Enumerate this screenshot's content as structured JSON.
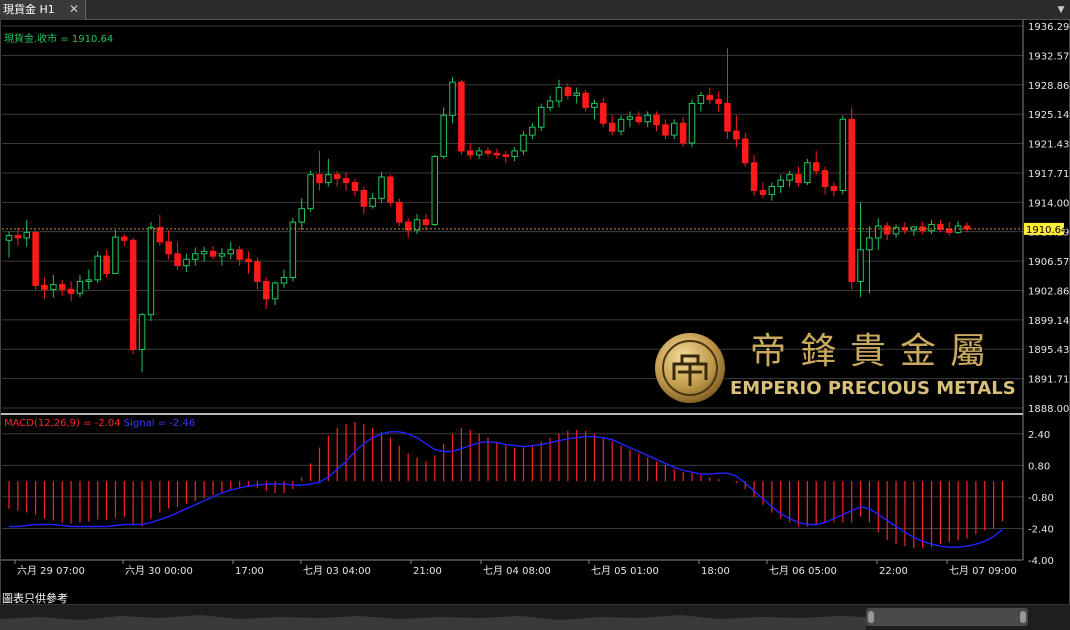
{
  "tab": {
    "title": "現貨金 H1",
    "close": "✕",
    "menu": "▼"
  },
  "legend": {
    "main": "現貨金.收市 = 1910.64",
    "macd_name": "MACD(12,26,9) = -2.04",
    "signal_name": "Signal = -2.46"
  },
  "price_axis": {
    "ticks": [
      "1936.29",
      "1932.57",
      "1928.86",
      "1925.14",
      "1921.43",
      "1917.71",
      "1914.00",
      "1910.29",
      "1906.57",
      "1902.86",
      "1899.14",
      "1895.43",
      "1891.71",
      "1888.00"
    ],
    "current_label": "1910.64"
  },
  "macd_axis": {
    "ticks": [
      "2.40",
      "0.80",
      "-0.80",
      "-2.40",
      "-4.00"
    ]
  },
  "time_axis": {
    "labels": [
      "六月 29 07:00",
      "六月 30 00:00",
      "17:00",
      "七月 03 04:00",
      "21:00",
      "七月 04 08:00",
      "七月 05 01:00",
      "18:00",
      "七月 06 05:00",
      "22:00",
      "七月 07 09:00"
    ]
  },
  "logo": {
    "cn": "帝鋒貴金屬",
    "en": "EMPERIO PRECIOUS METALS"
  },
  "footer": {
    "disclaimer": "圖表只供參考"
  },
  "colors": {
    "up": "#22c55e",
    "down": "#ff1a1a",
    "macd_hist": "#ff2222",
    "signal": "#2222ff",
    "grid": "#3c3c3c",
    "gold": "#c9a95d",
    "current": "#ffeb3b"
  },
  "chart_data": [
    {
      "type": "candlestick",
      "title": "現貨金 H1",
      "series_name": "現貨金.收市",
      "last_close": 1910.64,
      "ylim": [
        1888.0,
        1936.29
      ],
      "ohlc": [
        [
          1909.2,
          1910.3,
          1907.0,
          1909.8
        ],
        [
          1909.8,
          1910.8,
          1908.5,
          1909.5
        ],
        [
          1909.5,
          1911.8,
          1908.4,
          1910.2
        ],
        [
          1910.2,
          1910.5,
          1903.0,
          1903.5
        ],
        [
          1903.5,
          1904.5,
          1901.8,
          1903.0
        ],
        [
          1903.0,
          1904.8,
          1902.0,
          1903.6
        ],
        [
          1903.6,
          1904.2,
          1902.2,
          1903.0
        ],
        [
          1903.0,
          1904.0,
          1901.5,
          1902.5
        ],
        [
          1902.5,
          1904.8,
          1902.0,
          1904.0
        ],
        [
          1904.0,
          1905.5,
          1903.0,
          1904.2
        ],
        [
          1904.2,
          1907.8,
          1903.8,
          1907.2
        ],
        [
          1907.2,
          1908.0,
          1904.5,
          1905.0
        ],
        [
          1905.0,
          1910.5,
          1905.0,
          1909.6
        ],
        [
          1909.6,
          1910.0,
          1908.5,
          1909.2
        ],
        [
          1909.2,
          1909.5,
          1894.8,
          1895.4
        ],
        [
          1895.4,
          1900.0,
          1892.5,
          1899.8
        ],
        [
          1899.8,
          1911.5,
          1899.0,
          1910.8
        ],
        [
          1910.8,
          1912.4,
          1908.5,
          1909.0
        ],
        [
          1909.0,
          1910.5,
          1906.8,
          1907.5
        ],
        [
          1907.5,
          1909.0,
          1905.5,
          1906.0
        ],
        [
          1906.0,
          1907.5,
          1905.2,
          1906.8
        ],
        [
          1906.8,
          1908.3,
          1906.0,
          1907.5
        ],
        [
          1907.5,
          1908.4,
          1906.5,
          1907.8
        ],
        [
          1907.8,
          1908.5,
          1906.8,
          1907.2
        ],
        [
          1907.2,
          1908.2,
          1906.0,
          1907.5
        ],
        [
          1907.5,
          1909.0,
          1906.8,
          1908.0
        ],
        [
          1908.0,
          1908.5,
          1906.0,
          1906.8
        ],
        [
          1906.8,
          1907.8,
          1905.0,
          1906.5
        ],
        [
          1906.5,
          1907.0,
          1903.0,
          1904.0
        ],
        [
          1904.0,
          1904.5,
          1900.5,
          1901.8
        ],
        [
          1901.8,
          1904.0,
          1901.0,
          1903.8
        ],
        [
          1903.8,
          1905.5,
          1903.2,
          1904.5
        ],
        [
          1904.5,
          1912.0,
          1904.0,
          1911.5
        ],
        [
          1911.5,
          1914.5,
          1910.5,
          1913.2
        ],
        [
          1913.2,
          1918.0,
          1912.8,
          1917.5
        ],
        [
          1917.5,
          1920.5,
          1915.5,
          1916.5
        ],
        [
          1916.5,
          1919.5,
          1916.0,
          1917.5
        ],
        [
          1917.5,
          1918.0,
          1916.0,
          1917.0
        ],
        [
          1917.0,
          1917.8,
          1915.5,
          1916.5
        ],
        [
          1916.5,
          1917.0,
          1914.8,
          1915.5
        ],
        [
          1915.5,
          1916.0,
          1912.5,
          1913.5
        ],
        [
          1913.5,
          1915.2,
          1913.2,
          1914.5
        ],
        [
          1914.5,
          1917.8,
          1914.0,
          1917.2
        ],
        [
          1917.2,
          1917.5,
          1913.5,
          1914.0
        ],
        [
          1914.0,
          1914.5,
          1911.0,
          1911.5
        ],
        [
          1911.5,
          1912.0,
          1909.5,
          1910.5
        ],
        [
          1910.5,
          1912.5,
          1910.0,
          1911.8
        ],
        [
          1911.8,
          1912.5,
          1910.5,
          1911.2
        ],
        [
          1911.2,
          1920.0,
          1911.0,
          1919.8
        ],
        [
          1919.8,
          1926.0,
          1919.5,
          1925.0
        ],
        [
          1925.0,
          1929.8,
          1924.0,
          1929.2
        ],
        [
          1929.2,
          1929.5,
          1920.0,
          1920.5
        ],
        [
          1920.5,
          1921.5,
          1919.5,
          1920.0
        ],
        [
          1920.0,
          1921.0,
          1919.5,
          1920.5
        ],
        [
          1920.5,
          1921.0,
          1919.8,
          1920.2
        ],
        [
          1920.2,
          1920.8,
          1919.5,
          1920.0
        ],
        [
          1920.0,
          1920.5,
          1919.0,
          1919.8
        ],
        [
          1919.8,
          1921.0,
          1919.2,
          1920.5
        ],
        [
          1920.5,
          1923.0,
          1920.0,
          1922.5
        ],
        [
          1922.5,
          1924.0,
          1922.0,
          1923.5
        ],
        [
          1923.5,
          1926.5,
          1923.0,
          1926.0
        ],
        [
          1926.0,
          1927.5,
          1925.5,
          1926.8
        ],
        [
          1926.8,
          1929.5,
          1926.0,
          1928.5
        ],
        [
          1928.5,
          1929.0,
          1927.0,
          1927.5
        ],
        [
          1927.5,
          1928.5,
          1926.5,
          1927.8
        ],
        [
          1927.8,
          1928.2,
          1925.5,
          1926.0
        ],
        [
          1926.0,
          1927.0,
          1924.5,
          1926.5
        ],
        [
          1926.5,
          1927.2,
          1923.5,
          1924.0
        ],
        [
          1924.0,
          1925.0,
          1922.5,
          1923.0
        ],
        [
          1923.0,
          1925.0,
          1922.5,
          1924.5
        ],
        [
          1924.5,
          1925.5,
          1923.5,
          1924.8
        ],
        [
          1924.8,
          1925.5,
          1923.8,
          1924.2
        ],
        [
          1924.2,
          1925.5,
          1923.5,
          1925.0
        ],
        [
          1925.0,
          1925.5,
          1923.0,
          1923.8
        ],
        [
          1923.8,
          1924.5,
          1922.0,
          1922.5
        ],
        [
          1922.5,
          1924.5,
          1922.0,
          1924.0
        ],
        [
          1924.0,
          1924.8,
          1921.0,
          1921.5
        ],
        [
          1921.5,
          1927.0,
          1921.0,
          1926.5
        ],
        [
          1926.5,
          1928.0,
          1925.5,
          1927.5
        ],
        [
          1927.5,
          1928.5,
          1926.5,
          1927.0
        ],
        [
          1927.0,
          1928.0,
          1925.5,
          1926.5
        ],
        [
          1926.5,
          1933.5,
          1922.0,
          1923.0
        ],
        [
          1923.0,
          1925.0,
          1921.0,
          1922.0
        ],
        [
          1922.0,
          1922.8,
          1918.5,
          1919.0
        ],
        [
          1919.0,
          1920.0,
          1914.8,
          1915.5
        ],
        [
          1915.5,
          1916.5,
          1914.5,
          1915.0
        ],
        [
          1915.0,
          1916.5,
          1914.2,
          1916.0
        ],
        [
          1916.0,
          1917.5,
          1915.2,
          1916.8
        ],
        [
          1916.8,
          1918.0,
          1916.0,
          1917.5
        ],
        [
          1917.5,
          1918.5,
          1916.0,
          1916.5
        ],
        [
          1916.5,
          1919.5,
          1916.2,
          1919.0
        ],
        [
          1919.0,
          1920.5,
          1917.5,
          1918.0
        ],
        [
          1918.0,
          1918.5,
          1915.0,
          1916.0
        ],
        [
          1916.0,
          1916.5,
          1914.8,
          1915.5
        ],
        [
          1915.5,
          1925.0,
          1915.0,
          1924.5
        ],
        [
          1924.5,
          1926.0,
          1903.0,
          1904.0
        ],
        [
          1904.0,
          1914.0,
          1902.0,
          1908.0
        ],
        [
          1908.0,
          1911.0,
          1902.5,
          1909.5
        ],
        [
          1909.5,
          1912.0,
          1908.0,
          1911.0
        ],
        [
          1911.0,
          1911.5,
          1909.2,
          1910.0
        ],
        [
          1910.0,
          1911.2,
          1909.5,
          1910.8
        ],
        [
          1910.8,
          1911.5,
          1910.0,
          1910.5
        ],
        [
          1910.5,
          1911.0,
          1909.8,
          1910.9
        ],
        [
          1910.9,
          1911.5,
          1910.0,
          1910.4
        ],
        [
          1910.4,
          1911.8,
          1910.0,
          1911.2
        ],
        [
          1911.2,
          1911.8,
          1910.2,
          1910.6
        ],
        [
          1910.6,
          1911.5,
          1909.8,
          1910.2
        ],
        [
          1910.2,
          1911.6,
          1910.0,
          1911.0
        ],
        [
          1911.0,
          1911.5,
          1910.2,
          1910.64
        ]
      ]
    },
    {
      "type": "macd",
      "title": "MACD(12,26,9)",
      "macd_last": -2.04,
      "signal_last": -2.46,
      "ylim": [
        -4.0,
        3.2
      ],
      "macd": [
        -1.4,
        -1.5,
        -1.6,
        -1.7,
        -1.9,
        -2.0,
        -2.1,
        -2.15,
        -2.1,
        -2.05,
        -1.95,
        -1.95,
        -1.85,
        -1.8,
        -2.15,
        -2.3,
        -1.9,
        -1.6,
        -1.4,
        -1.3,
        -1.15,
        -1.0,
        -0.85,
        -0.7,
        -0.55,
        -0.45,
        -0.35,
        -0.3,
        -0.35,
        -0.5,
        -0.6,
        -0.6,
        -0.4,
        0.2,
        0.9,
        1.7,
        2.3,
        2.7,
        2.9,
        3.0,
        2.9,
        2.7,
        2.5,
        2.2,
        1.8,
        1.4,
        1.2,
        1.0,
        1.3,
        1.9,
        2.4,
        2.7,
        2.6,
        2.4,
        2.2,
        2.0,
        1.8,
        1.7,
        1.7,
        1.8,
        2.0,
        2.2,
        2.4,
        2.55,
        2.6,
        2.55,
        2.4,
        2.2,
        2.0,
        1.8,
        1.6,
        1.4,
        1.2,
        1.0,
        0.8,
        0.6,
        0.45,
        0.4,
        0.3,
        0.2,
        0.1,
        0.0,
        -0.1,
        -0.4,
        -0.8,
        -1.2,
        -1.6,
        -1.9,
        -2.1,
        -2.3,
        -2.3,
        -2.2,
        -2.1,
        -2.1,
        -2.1,
        -2.1,
        -1.8,
        -2.1,
        -2.6,
        -3.0,
        -3.2,
        -3.3,
        -3.4,
        -3.4,
        -3.35,
        -3.2,
        -3.1,
        -3.0,
        -2.9,
        -2.7,
        -2.5,
        -2.4,
        -2.04
      ],
      "signal": [
        -2.3,
        -2.3,
        -2.25,
        -2.2,
        -2.2,
        -2.2,
        -2.25,
        -2.3,
        -2.3,
        -2.3,
        -2.3,
        -2.3,
        -2.25,
        -2.2,
        -2.2,
        -2.2,
        -2.1,
        -1.95,
        -1.8,
        -1.6,
        -1.4,
        -1.2,
        -1.0,
        -0.8,
        -0.6,
        -0.45,
        -0.35,
        -0.25,
        -0.2,
        -0.15,
        -0.15,
        -0.15,
        -0.2,
        -0.2,
        -0.15,
        -0.05,
        0.2,
        0.6,
        1.0,
        1.5,
        1.9,
        2.2,
        2.4,
        2.5,
        2.5,
        2.4,
        2.2,
        1.9,
        1.6,
        1.5,
        1.5,
        1.65,
        1.8,
        1.95,
        2.0,
        1.95,
        1.85,
        1.8,
        1.75,
        1.8,
        1.85,
        1.95,
        2.05,
        2.15,
        2.2,
        2.25,
        2.25,
        2.2,
        2.1,
        1.9,
        1.7,
        1.5,
        1.3,
        1.1,
        0.9,
        0.7,
        0.55,
        0.45,
        0.35,
        0.35,
        0.4,
        0.4,
        0.25,
        -0.1,
        -0.5,
        -0.9,
        -1.3,
        -1.65,
        -1.9,
        -2.1,
        -2.2,
        -2.2,
        -2.1,
        -1.9,
        -1.7,
        -1.5,
        -1.3,
        -1.4,
        -1.7,
        -2.0,
        -2.3,
        -2.6,
        -2.85,
        -3.05,
        -3.2,
        -3.3,
        -3.35,
        -3.35,
        -3.3,
        -3.2,
        -3.05,
        -2.8,
        -2.46
      ]
    }
  ]
}
